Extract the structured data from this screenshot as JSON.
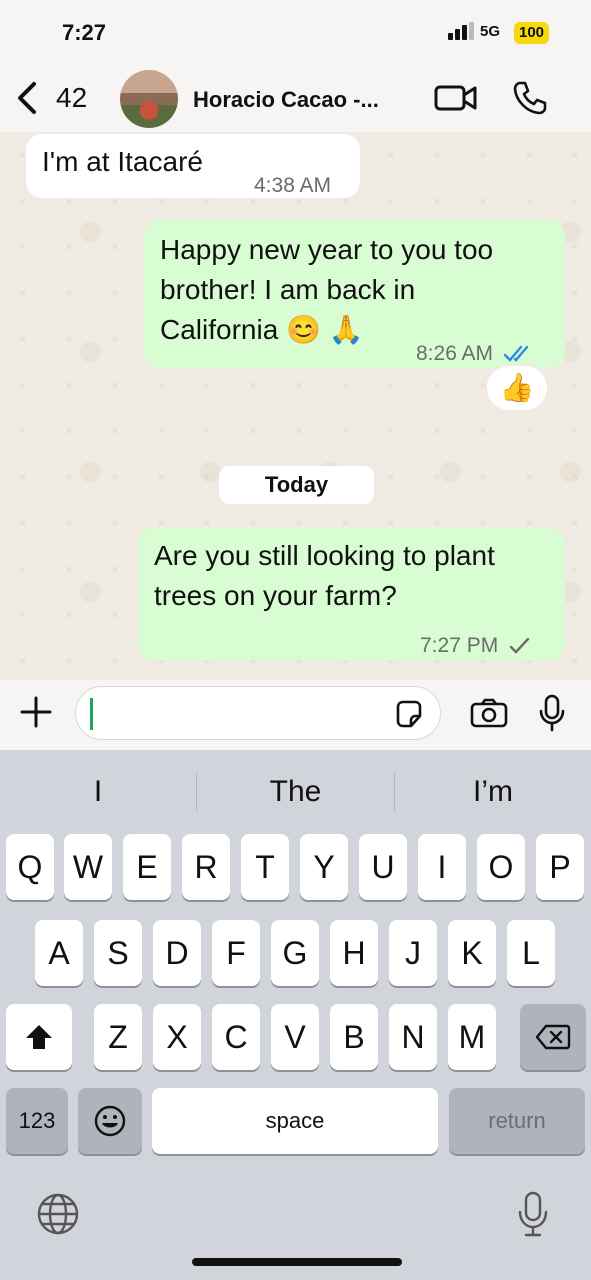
{
  "status": {
    "time": "7:27",
    "network": "5G",
    "battery": "100"
  },
  "header": {
    "back_count": "42",
    "contact_name": "Horacio Cacao -..."
  },
  "messages": [
    {
      "direction": "in",
      "text": "I'm at Itacaré",
      "time": "4:38 AM"
    },
    {
      "direction": "out",
      "lines": [
        "Happy new year to you too",
        "brother! I am back in",
        "California 😊 🙏"
      ],
      "time": "8:26 AM",
      "status": "read"
    },
    {
      "reaction": "👍"
    },
    {
      "day_separator": "Today"
    },
    {
      "direction": "out",
      "lines": [
        "Are you still looking to plant",
        "trees on your farm?"
      ],
      "time": "7:27 PM",
      "status": "sent"
    }
  ],
  "input": {
    "value": "",
    "placeholder": ""
  },
  "keyboard": {
    "suggestions": [
      "I",
      "The",
      "I’m"
    ],
    "row1": [
      "Q",
      "W",
      "E",
      "R",
      "T",
      "Y",
      "U",
      "I",
      "O",
      "P"
    ],
    "row2": [
      "A",
      "S",
      "D",
      "F",
      "G",
      "H",
      "J",
      "K",
      "L"
    ],
    "row3": [
      "Z",
      "X",
      "C",
      "V",
      "B",
      "N",
      "M"
    ],
    "numbers_label": "123",
    "space_label": "space",
    "return_label": "return"
  },
  "colors": {
    "incoming": "#ffffff",
    "outgoing": "#d9fdd3",
    "read_ticks": "#2f8be0",
    "background": "#efeae2"
  }
}
